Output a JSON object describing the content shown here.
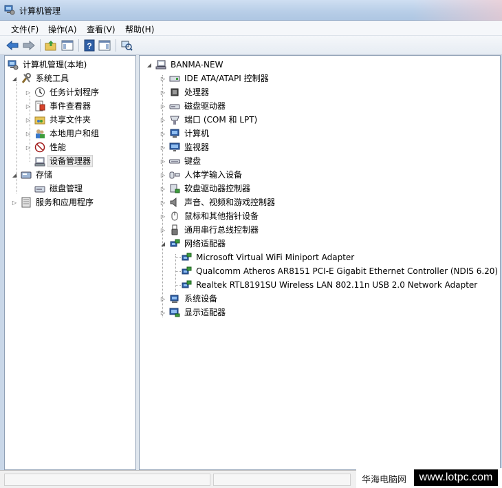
{
  "window": {
    "title": "计算机管理"
  },
  "menubar": {
    "items": [
      "文件(F)",
      "操作(A)",
      "查看(V)",
      "帮助(H)"
    ]
  },
  "toolbar": {
    "buttons": [
      "back-arrow-icon",
      "forward-arrow-icon",
      "up-folder-icon",
      "show-hide-tree-icon",
      "help-icon",
      "show-hide-action-pane-icon",
      "scan-hardware-icon"
    ]
  },
  "left_tree": {
    "root": "计算机管理(本地)",
    "system_tools": "系统工具",
    "task_scheduler": "任务计划程序",
    "event_viewer": "事件查看器",
    "shared_folders": "共享文件夹",
    "local_users": "本地用户和组",
    "performance": "性能",
    "device_manager": "设备管理器",
    "storage": "存储",
    "disk_management": "磁盘管理",
    "services_apps": "服务和应用程序"
  },
  "device_tree": {
    "computer_name": "BANMA-NEW",
    "categories": [
      {
        "label": "IDE ATA/ATAPI 控制器",
        "icon": "ide-controller-icon"
      },
      {
        "label": "处理器",
        "icon": "processor-icon"
      },
      {
        "label": "磁盘驱动器",
        "icon": "disk-drive-icon"
      },
      {
        "label": "端口 (COM 和 LPT)",
        "icon": "port-icon"
      },
      {
        "label": "计算机",
        "icon": "computer-icon"
      },
      {
        "label": "监视器",
        "icon": "monitor-icon"
      },
      {
        "label": "键盘",
        "icon": "keyboard-icon"
      },
      {
        "label": "人体学输入设备",
        "icon": "hid-icon"
      },
      {
        "label": "软盘驱动器控制器",
        "icon": "floppy-controller-icon"
      },
      {
        "label": "声音、视频和游戏控制器",
        "icon": "sound-icon"
      },
      {
        "label": "鼠标和其他指针设备",
        "icon": "mouse-icon"
      },
      {
        "label": "通用串行总线控制器",
        "icon": "usb-icon"
      },
      {
        "label": "网络适配器",
        "icon": "network-adapter-icon",
        "expanded": true
      },
      {
        "label": "系统设备",
        "icon": "system-devices-icon"
      },
      {
        "label": "显示适配器",
        "icon": "display-adapter-icon"
      }
    ],
    "network_adapters": [
      "Microsoft Virtual WiFi Miniport Adapter",
      "Qualcomm Atheros AR8151 PCI-E Gigabit Ethernet Controller (NDIS 6.20)",
      "Realtek RTL8191SU Wireless LAN 802.11n USB 2.0 Network Adapter"
    ]
  },
  "watermark": {
    "site_name": "华海电脑网",
    "url": "www.lotpc.com"
  }
}
